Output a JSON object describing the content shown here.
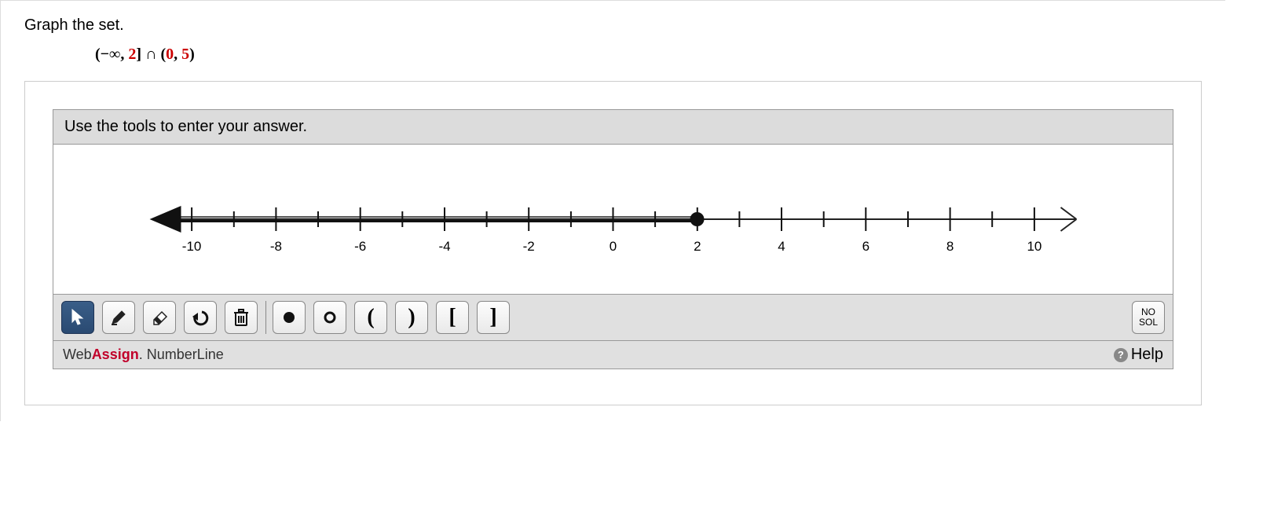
{
  "question": {
    "prompt": "Graph the set.",
    "expression": {
      "left_open": "(−∞, ",
      "left_end": "2",
      "left_close": "]",
      "op": " ∩ ",
      "right_open": "(",
      "right_start": "0",
      "right_sep": ", ",
      "right_end": "5",
      "right_close": ")"
    }
  },
  "widget": {
    "header": "Use the tools to enter your answer.",
    "axis": {
      "min": -11,
      "max": 11,
      "tick_labels": [
        "-10",
        "-8",
        "-6",
        "-4",
        "-2",
        "0",
        "2",
        "4",
        "6",
        "8",
        "10"
      ],
      "tick_values": [
        -10,
        -8,
        -6,
        -4,
        -2,
        0,
        2,
        4,
        6,
        8,
        10
      ]
    },
    "plotted": {
      "ray_from_neg_inf_to": 2,
      "endpoint_closed": true
    },
    "tools": {
      "pointer": "select",
      "draw": "draw",
      "erase": "erase",
      "undo": "undo",
      "clear": "clear",
      "closed_point": "●",
      "open_point": "○",
      "open_left": "(",
      "open_right": ")",
      "closed_left": "[",
      "closed_right": "]",
      "nosol_line1": "NO",
      "nosol_line2": "SOL"
    },
    "footer": {
      "brand_web": "Web",
      "brand_assign": "Assign",
      "brand_dot": ".",
      "brand_suffix": " NumberLine",
      "help": "Help"
    }
  },
  "chart_data": {
    "type": "numberline",
    "xmin": -11,
    "xmax": 11,
    "ticks": [
      -10,
      -9,
      -8,
      -7,
      -6,
      -5,
      -4,
      -3,
      -2,
      -1,
      0,
      1,
      2,
      3,
      4,
      5,
      6,
      7,
      8,
      9,
      10
    ],
    "labeled_ticks": {
      "-10": -10,
      "-8": -8,
      "-6": -6,
      "-4": -4,
      "-2": -2,
      "0": 0,
      "2": 2,
      "4": 4,
      "6": 6,
      "8": 8,
      "10": 10
    },
    "intervals": [
      {
        "from": "-inf",
        "to": 2,
        "left": "open-arrow",
        "right": "closed"
      }
    ],
    "title": "",
    "xlabel": "",
    "ylabel": ""
  }
}
